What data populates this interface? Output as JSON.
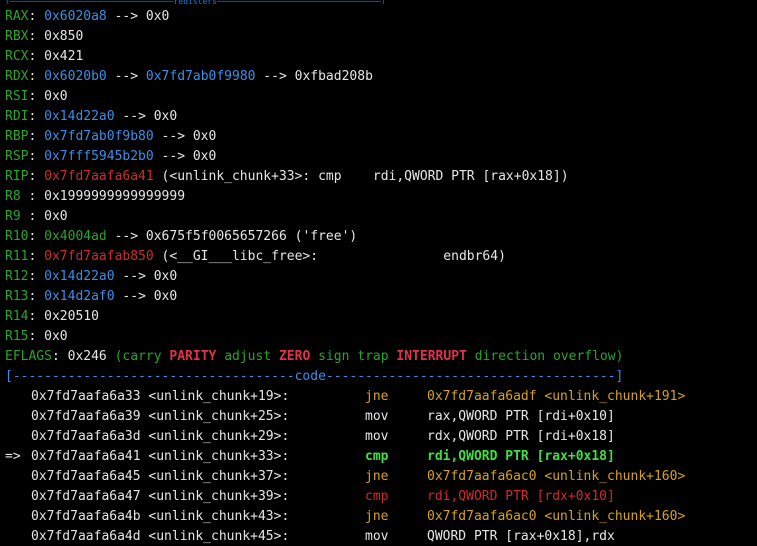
{
  "colors": {
    "register_label": "#2aa52a",
    "pointer_value": "#3b8ee8",
    "code_pointer": "#d12a2a",
    "flag_set": "#e0334a",
    "separator": "#3b8ee8",
    "branch_instruction": "#d9a11a",
    "current_instruction": "#3fe03f"
  },
  "top_fragment": "[──────────────────────────────────registers──────────────────────────────────]",
  "registers": [
    {
      "name": "RAX",
      "parts": [
        {
          "t": "0x6020a8",
          "c": "blue"
        },
        {
          "t": " --> ",
          "c": "white"
        },
        {
          "t": "0x0",
          "c": "white"
        }
      ]
    },
    {
      "name": "RBX",
      "parts": [
        {
          "t": "0x850",
          "c": "white"
        }
      ]
    },
    {
      "name": "RCX",
      "parts": [
        {
          "t": "0x421",
          "c": "white"
        }
      ]
    },
    {
      "name": "RDX",
      "parts": [
        {
          "t": "0x6020b0",
          "c": "blue"
        },
        {
          "t": " --> ",
          "c": "white"
        },
        {
          "t": "0x7fd7ab0f9980",
          "c": "blue"
        },
        {
          "t": " --> ",
          "c": "white"
        },
        {
          "t": "0xfbad208b",
          "c": "white"
        }
      ]
    },
    {
      "name": "RSI",
      "parts": [
        {
          "t": "0x0",
          "c": "white"
        }
      ]
    },
    {
      "name": "RDI",
      "parts": [
        {
          "t": "0x14d22a0",
          "c": "blue"
        },
        {
          "t": " --> ",
          "c": "white"
        },
        {
          "t": "0x0",
          "c": "white"
        }
      ]
    },
    {
      "name": "RBP",
      "parts": [
        {
          "t": "0x7fd7ab0f9b80",
          "c": "blue"
        },
        {
          "t": " --> ",
          "c": "white"
        },
        {
          "t": "0x0",
          "c": "white"
        }
      ]
    },
    {
      "name": "RSP",
      "parts": [
        {
          "t": "0x7fff5945b2b0",
          "c": "blue"
        },
        {
          "t": " --> ",
          "c": "white"
        },
        {
          "t": "0x0",
          "c": "white"
        }
      ]
    },
    {
      "name": "RIP",
      "parts": [
        {
          "t": "0x7fd7aafa6a41",
          "c": "red"
        },
        {
          "t": " (<unlink_chunk+33>:\tcmp    rdi,QWORD PTR [rax+0x18])",
          "c": "white"
        }
      ]
    },
    {
      "name": "R8 ",
      "parts": [
        {
          "t": "0x1999999999999999",
          "c": "white"
        }
      ]
    },
    {
      "name": "R9 ",
      "parts": [
        {
          "t": "0x0",
          "c": "white"
        }
      ]
    },
    {
      "name": "R10",
      "parts": [
        {
          "t": "0x4004ad",
          "c": "dim-green"
        },
        {
          "t": " --> ",
          "c": "white"
        },
        {
          "t": "0x675f5f0065657266 ('free')",
          "c": "white"
        }
      ]
    },
    {
      "name": "R11",
      "parts": [
        {
          "t": "0x7fd7aafab850",
          "c": "red"
        },
        {
          "t": " (<__GI___libc_free>:\t        endbr64)",
          "c": "white"
        }
      ]
    },
    {
      "name": "R12",
      "parts": [
        {
          "t": "0x14d22a0",
          "c": "blue"
        },
        {
          "t": " --> ",
          "c": "white"
        },
        {
          "t": "0x0",
          "c": "white"
        }
      ]
    },
    {
      "name": "R13",
      "parts": [
        {
          "t": "0x14d2af0",
          "c": "blue"
        },
        {
          "t": " --> ",
          "c": "white"
        },
        {
          "t": "0x0",
          "c": "white"
        }
      ]
    },
    {
      "name": "R14",
      "parts": [
        {
          "t": "0x20510",
          "c": "white"
        }
      ]
    },
    {
      "name": "R15",
      "parts": [
        {
          "t": "0x0",
          "c": "white"
        }
      ]
    }
  ],
  "eflags": {
    "name": "EFLAGS",
    "value": "0x246",
    "flags": [
      {
        "t": "carry",
        "on": false
      },
      {
        "t": "PARITY",
        "on": true
      },
      {
        "t": "adjust",
        "on": false
      },
      {
        "t": "ZERO",
        "on": true
      },
      {
        "t": "sign",
        "on": false
      },
      {
        "t": "trap",
        "on": false
      },
      {
        "t": "INTERRUPT",
        "on": true
      },
      {
        "t": "direction",
        "on": false
      },
      {
        "t": "overflow",
        "on": false
      }
    ]
  },
  "code_separator": {
    "left": "[------------------------------------",
    "title": "code",
    "right": "-------------------------------------]"
  },
  "instructions": [
    {
      "arrow": "",
      "addr": "0x7fd7aafa6a33 <unlink_chunk+19>:",
      "mnem": "jne",
      "ops": "0x7fd7aafa6adf <unlink_chunk+191>",
      "style": "branch"
    },
    {
      "arrow": "",
      "addr": "0x7fd7aafa6a39 <unlink_chunk+25>:",
      "mnem": "mov",
      "ops": "rax,QWORD PTR [rdi+0x10]",
      "style": "normal"
    },
    {
      "arrow": "",
      "addr": "0x7fd7aafa6a3d <unlink_chunk+29>:",
      "mnem": "mov",
      "ops": "rdx,QWORD PTR [rdi+0x18]",
      "style": "normal"
    },
    {
      "arrow": "=>",
      "addr": "0x7fd7aafa6a41 <unlink_chunk+33>:",
      "mnem": "cmp",
      "ops": "rdi,QWORD PTR [rax+0x18]",
      "style": "current"
    },
    {
      "arrow": "",
      "addr": "0x7fd7aafa6a45 <unlink_chunk+37>:",
      "mnem": "jne",
      "ops": "0x7fd7aafa6ac0 <unlink_chunk+160>",
      "style": "branch"
    },
    {
      "arrow": "",
      "addr": "0x7fd7aafa6a47 <unlink_chunk+39>:",
      "mnem": "cmp",
      "ops": "rdi,QWORD PTR [rdx+0x10]",
      "style": "red"
    },
    {
      "arrow": "",
      "addr": "0x7fd7aafa6a4b <unlink_chunk+43>:",
      "mnem": "jne",
      "ops": "0x7fd7aafa6ac0 <unlink_chunk+160>",
      "style": "branch"
    },
    {
      "arrow": "",
      "addr": "0x7fd7aafa6a4d <unlink_chunk+45>:",
      "mnem": "mov",
      "ops": "QWORD PTR [rax+0x18],rdx",
      "style": "normal"
    }
  ]
}
